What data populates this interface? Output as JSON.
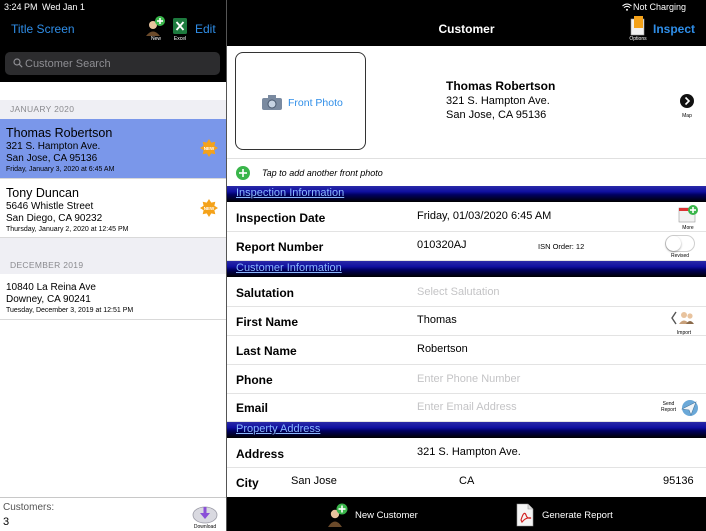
{
  "status_bar": {
    "time": "3:24 PM",
    "date": "Wed Jan 1",
    "battery": "Not Charging"
  },
  "left_pane": {
    "nav": {
      "title_screen": "Title Screen",
      "new_caption": "New",
      "excel_caption": "Excel",
      "edit": "Edit"
    },
    "search": {
      "placeholder": "Customer Search"
    },
    "sections": [
      {
        "header": "JANUARY 2020",
        "items": [
          {
            "name": "Thomas Robertson",
            "addr1": "321 S. Hampton Ave.",
            "addr2": "San Jose, CA 95136",
            "date": "Friday, January 3, 2020 at 6:45 AM",
            "badge": "NEW",
            "selected": true
          },
          {
            "name": "Tony Duncan",
            "addr1": "5646 Whistle Street",
            "addr2": "San Diego, CA 90232",
            "date": "Thursday, January 2, 2020 at 12:45 PM",
            "badge": "NEW",
            "selected": false
          }
        ]
      },
      {
        "header": "DECEMBER 2019",
        "items": [
          {
            "name": "",
            "addr1": "10840 La Reina Ave",
            "addr2": "Downey, CA 90241",
            "date": "Tuesday, December 3, 2019 at 12:51 PM",
            "badge": "",
            "selected": false
          }
        ]
      }
    ],
    "footer": {
      "customers_label": "Customers:",
      "customers_count": "3",
      "download_caption": "Download"
    }
  },
  "right_pane": {
    "nav": {
      "title": "Customer",
      "options_caption": "Options",
      "inspect": "Inspect"
    },
    "header": {
      "front_photo": "Front Photo",
      "name": "Thomas Robertson",
      "addr1": "321 S. Hampton Ave.",
      "addr2": "San Jose, CA 95136",
      "map_caption": "Map",
      "add_photo": "Tap to add another front photo"
    },
    "inspection": {
      "section_title": "Inspection Information",
      "inspection_date_label": "Inspection Date",
      "inspection_date_value": "Friday, 01/03/2020 6:45 AM",
      "more_caption": "More",
      "report_number_label": "Report Number",
      "report_number_value": "010320AJ",
      "isn_order": "ISN Order: 12",
      "revised_caption": "Revised"
    },
    "customer": {
      "section_title": "Customer Information",
      "salutation_label": "Salutation",
      "salutation_placeholder": "Select Salutation",
      "first_name_label": "First Name",
      "first_name_value": "Thomas",
      "import_caption": "Import",
      "last_name_label": "Last Name",
      "last_name_value": "Robertson",
      "phone_label": "Phone",
      "phone_placeholder": "Enter Phone Number",
      "email_label": "Email",
      "email_placeholder": "Enter Email Address",
      "send_report_caption_1": "Send",
      "send_report_caption_2": "Report"
    },
    "property": {
      "section_title": "Property Address",
      "address_label": "Address",
      "address_value": "321 S. Hampton Ave.",
      "city_label": "City",
      "city_value": "San Jose",
      "state_value": "CA",
      "zip_value": "95136"
    },
    "toolbar": {
      "new_customer": "New Customer",
      "generate_report": "Generate Report"
    }
  },
  "colors": {
    "accent": "#2f8ee8",
    "selected_row": "#7a97ea",
    "section_band_top": "#2a2aa8",
    "section_band_text": "#8ab8ff",
    "badge_orange": "#f4a21a"
  }
}
